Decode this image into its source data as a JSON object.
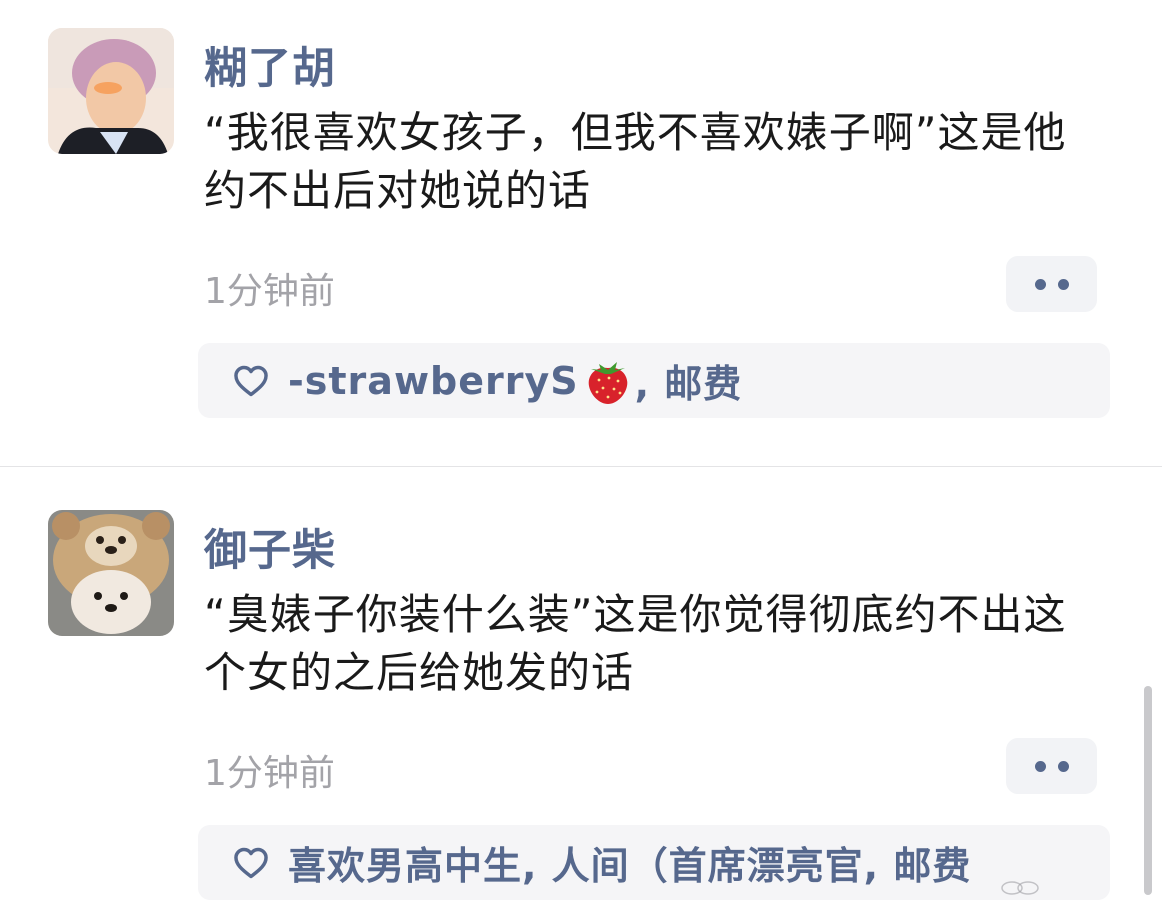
{
  "comments": [
    {
      "username": "糊了胡",
      "text": "“我很喜欢女孩子，但我不喜欢婊子啊”这是他约不出后对她说的话",
      "time": "1分钟前",
      "likes_prefix": "-strawberryS",
      "likes_emoji": "strawberry-icon",
      "likes_suffix": ", 邮费"
    },
    {
      "username": "御子柴",
      "text": "“臭婊子你装什么装”这是你觉得彻底约不出这个女的之后给她发的话",
      "time": "1分钟前",
      "likes_text": "喜欢男高中生, 人间（首席漂亮官, 邮费"
    }
  ],
  "colors": {
    "username": "#56688d",
    "body_text": "#1a1a1a",
    "timestamp": "#a3a3a8",
    "likes_bg": "#f5f5f7",
    "more_bg": "#f2f3f6"
  }
}
